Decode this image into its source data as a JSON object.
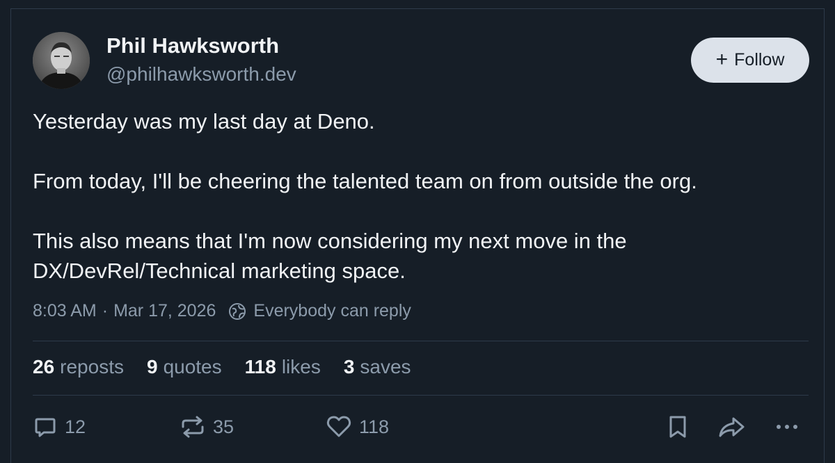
{
  "author": {
    "name": "Phil Hawksworth",
    "handle": "@philhawksworth.dev"
  },
  "follow_button": {
    "icon": "plus-icon",
    "label": "Follow"
  },
  "post": {
    "paragraphs": [
      "Yesterday was my last day at Deno.",
      "From today, I'll be cheering the talented team on from outside the org.",
      "This also means that I'm now considering my next move in the DX/DevRel/Technical marketing space."
    ],
    "time": "8:03 AM",
    "separator": "·",
    "date": "Mar 17, 2026",
    "reply_setting": "Everybody can reply"
  },
  "stats": [
    {
      "count": "26",
      "label": "reposts"
    },
    {
      "count": "9",
      "label": "quotes"
    },
    {
      "count": "118",
      "label": "likes"
    },
    {
      "count": "3",
      "label": "saves"
    }
  ],
  "actions": {
    "reply_count": "12",
    "repost_count": "35",
    "like_count": "118"
  },
  "colors": {
    "background": "#161e27",
    "text": "#f1f3f5",
    "muted": "#8c9bab",
    "divider": "#2e3b4a",
    "button_bg": "#dce2ea"
  }
}
